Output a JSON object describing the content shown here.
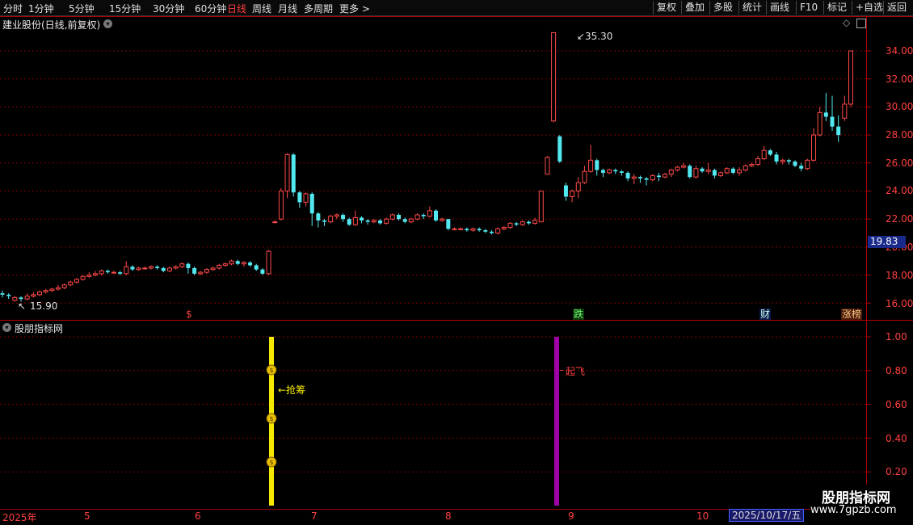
{
  "toolbar": {
    "periods": [
      "分时",
      "1分钟",
      "5分钟",
      "15分钟",
      "30分钟",
      "60分钟",
      "日线",
      "周线",
      "月线",
      "多周期",
      "更多 >"
    ],
    "active_period": "日线",
    "right_buttons": [
      "复权",
      "叠加",
      "多股",
      "统计",
      "画线",
      "F10",
      "标记",
      "+自选",
      "返回"
    ]
  },
  "stock_title": "建业股份(日线,前复权)",
  "indicator_title": "股朋指标网",
  "price_axis": [
    "34.00",
    "32.00",
    "30.00",
    "28.00",
    "26.00",
    "24.00",
    "22.00",
    "20.00",
    "18.00",
    "16.00"
  ],
  "current_price_tag": "19.83",
  "indicator_axis": [
    "1.00",
    "0.80",
    "0.60",
    "0.40",
    "0.20"
  ],
  "annotations": {
    "high": "35.30",
    "low": "15.90",
    "grab_chips": "←抢筹",
    "take_off": "起飞"
  },
  "badges": {
    "s_marker": "$",
    "fall": "跌",
    "finance": "财",
    "surge_list": "涨榜"
  },
  "dates": {
    "year": "2025年",
    "m5": "5",
    "m6": "6",
    "m7": "7",
    "m8": "8",
    "m9": "9",
    "m10": "10",
    "current_date": "2025/10/17/五"
  },
  "watermark": {
    "name": "股朋指标网",
    "url": "www.7gpzb.com"
  },
  "colors": {
    "up": "#ff4a4a",
    "down": "#52e8f0",
    "grid": "#7a0000",
    "bar_yellow": "#f5e800",
    "bar_purple": "#a000a8"
  },
  "chart_data": {
    "type": "candlestick",
    "ylim": [
      15.5,
      35.5
    ],
    "indicator_ylim": [
      0,
      1.05
    ],
    "indicator_bars": [
      {
        "label": "抢筹",
        "value": 1.0,
        "color": "yellow"
      },
      {
        "label": "起飞",
        "value": 1.0,
        "color": "purple"
      }
    ],
    "candles": [
      [
        16.7,
        16.6,
        16.9,
        16.4
      ],
      [
        16.6,
        16.5,
        16.7,
        16.3
      ],
      [
        16.2,
        16.4,
        16.5,
        16.1
      ],
      [
        16.4,
        16.3,
        16.5,
        16.1
      ],
      [
        16.3,
        16.5,
        16.7,
        16.2
      ],
      [
        16.5,
        16.6,
        16.8,
        16.4
      ],
      [
        16.6,
        16.8,
        16.9,
        16.5
      ],
      [
        16.8,
        16.9,
        17.0,
        16.7
      ],
      [
        16.9,
        17.0,
        17.1,
        16.8
      ],
      [
        17.0,
        17.1,
        17.3,
        16.9
      ],
      [
        17.1,
        17.3,
        17.4,
        17.0
      ],
      [
        17.3,
        17.5,
        17.6,
        17.2
      ],
      [
        17.5,
        17.7,
        17.8,
        17.4
      ],
      [
        17.7,
        17.9,
        18.0,
        17.6
      ],
      [
        17.9,
        18.0,
        18.2,
        17.8
      ],
      [
        18.0,
        18.1,
        18.3,
        17.9
      ],
      [
        18.1,
        18.3,
        18.4,
        18.0
      ],
      [
        18.3,
        18.2,
        18.4,
        18.1
      ],
      [
        18.2,
        18.2,
        18.3,
        18.1
      ],
      [
        18.2,
        18.1,
        18.3,
        18.0
      ],
      [
        18.1,
        18.6,
        19.0,
        18.0
      ],
      [
        18.6,
        18.4,
        18.7,
        18.3
      ],
      [
        18.4,
        18.5,
        18.6,
        18.3
      ],
      [
        18.5,
        18.5,
        18.6,
        18.4
      ],
      [
        18.5,
        18.6,
        18.7,
        18.4
      ],
      [
        18.6,
        18.5,
        18.7,
        18.4
      ],
      [
        18.5,
        18.3,
        18.6,
        18.2
      ],
      [
        18.3,
        18.5,
        18.6,
        18.2
      ],
      [
        18.5,
        18.6,
        18.7,
        18.4
      ],
      [
        18.6,
        18.8,
        18.9,
        18.5
      ],
      [
        18.8,
        18.5,
        18.9,
        18.1
      ],
      [
        18.5,
        18.1,
        18.6,
        18.0
      ],
      [
        18.1,
        18.2,
        18.3,
        18.0
      ],
      [
        18.2,
        18.4,
        18.5,
        18.1
      ],
      [
        18.4,
        18.5,
        18.6,
        18.3
      ],
      [
        18.5,
        18.7,
        18.8,
        18.4
      ],
      [
        18.7,
        18.8,
        18.9,
        18.6
      ],
      [
        18.8,
        19.0,
        19.1,
        18.7
      ],
      [
        19.0,
        18.8,
        19.1,
        18.7
      ],
      [
        18.8,
        18.9,
        19.0,
        18.6
      ],
      [
        18.9,
        18.7,
        19.0,
        18.6
      ],
      [
        18.7,
        18.4,
        18.8,
        18.3
      ],
      [
        18.4,
        18.1,
        18.5,
        18.0
      ],
      [
        18.1,
        19.7,
        19.8,
        18.0
      ],
      [
        21.8,
        21.8,
        21.9,
        21.7
      ],
      [
        22.0,
        24.0,
        24.2,
        21.9
      ],
      [
        24.0,
        26.6,
        26.7,
        23.5
      ],
      [
        26.6,
        23.9,
        26.7,
        23.6
      ],
      [
        23.9,
        23.2,
        24.0,
        22.8
      ],
      [
        23.2,
        23.8,
        23.9,
        22.9
      ],
      [
        23.8,
        22.4,
        23.9,
        21.5
      ],
      [
        22.4,
        21.9,
        22.5,
        21.4
      ],
      [
        21.9,
        21.8,
        22.0,
        21.5
      ],
      [
        21.8,
        22.2,
        22.3,
        21.7
      ],
      [
        22.2,
        22.3,
        22.4,
        22.0
      ],
      [
        22.3,
        22.0,
        22.4,
        21.8
      ],
      [
        22.0,
        21.6,
        22.1,
        21.5
      ],
      [
        21.6,
        22.1,
        22.6,
        21.5
      ],
      [
        22.1,
        21.9,
        22.2,
        21.7
      ],
      [
        21.9,
        21.8,
        22.0,
        21.6
      ],
      [
        21.8,
        21.9,
        22.0,
        21.7
      ],
      [
        21.9,
        21.7,
        22.0,
        21.6
      ],
      [
        21.7,
        22.0,
        22.1,
        21.6
      ],
      [
        22.0,
        22.3,
        22.4,
        21.9
      ],
      [
        22.3,
        22.0,
        22.4,
        21.9
      ],
      [
        22.0,
        21.8,
        22.1,
        21.7
      ],
      [
        21.8,
        22.0,
        22.1,
        21.7
      ],
      [
        22.0,
        22.3,
        22.4,
        21.9
      ],
      [
        22.3,
        22.2,
        22.4,
        22.0
      ],
      [
        22.2,
        22.6,
        22.9,
        22.1
      ],
      [
        22.6,
        21.9,
        22.7,
        21.8
      ],
      [
        21.9,
        22.0,
        22.1,
        21.8
      ],
      [
        22.0,
        21.3,
        22.0,
        21.2
      ],
      [
        21.3,
        21.3,
        21.4,
        21.2
      ],
      [
        21.3,
        21.3,
        21.4,
        21.2
      ],
      [
        21.3,
        21.2,
        21.4,
        21.1
      ],
      [
        21.2,
        21.3,
        21.4,
        21.1
      ],
      [
        21.3,
        21.2,
        21.4,
        21.1
      ],
      [
        21.2,
        21.1,
        21.3,
        21.0
      ],
      [
        21.1,
        21.0,
        21.2,
        20.9
      ],
      [
        21.0,
        21.3,
        21.4,
        20.9
      ],
      [
        21.3,
        21.4,
        21.5,
        21.2
      ],
      [
        21.4,
        21.7,
        21.8,
        21.3
      ],
      [
        21.7,
        21.6,
        21.8,
        21.5
      ],
      [
        21.6,
        21.8,
        21.9,
        21.5
      ],
      [
        21.8,
        21.7,
        21.9,
        21.6
      ],
      [
        21.7,
        21.9,
        22.1,
        21.6
      ],
      [
        21.8,
        24.0,
        24.0,
        21.8
      ],
      [
        25.2,
        26.4,
        26.5,
        25.2
      ],
      [
        29.0,
        35.3,
        35.3,
        28.9
      ],
      [
        27.9,
        26.1,
        28.0,
        26.0
      ],
      [
        24.4,
        23.6,
        24.6,
        23.3
      ],
      [
        23.6,
        24.0,
        24.1,
        23.2
      ],
      [
        24.0,
        24.6,
        25.0,
        23.5
      ],
      [
        24.6,
        25.4,
        25.8,
        24.5
      ],
      [
        25.4,
        26.2,
        27.3,
        25.3
      ],
      [
        26.2,
        25.5,
        26.3,
        25.1
      ],
      [
        25.5,
        25.3,
        25.6,
        25.0
      ],
      [
        25.3,
        25.5,
        25.6,
        25.2
      ],
      [
        25.5,
        25.4,
        25.6,
        25.2
      ],
      [
        25.4,
        25.3,
        25.5,
        25.1
      ],
      [
        25.3,
        24.9,
        25.4,
        24.7
      ],
      [
        24.9,
        25.0,
        25.2,
        24.5
      ],
      [
        25.0,
        24.9,
        25.1,
        24.6
      ],
      [
        24.9,
        24.8,
        25.0,
        24.4
      ],
      [
        24.8,
        25.1,
        25.2,
        24.7
      ],
      [
        25.1,
        25.0,
        25.3,
        24.7
      ],
      [
        25.0,
        25.2,
        25.3,
        24.9
      ],
      [
        25.2,
        25.5,
        25.6,
        25.0
      ],
      [
        25.5,
        25.7,
        25.8,
        25.4
      ],
      [
        25.7,
        25.8,
        26.0,
        25.6
      ],
      [
        25.8,
        25.0,
        25.9,
        24.9
      ],
      [
        25.0,
        25.6,
        25.8,
        24.9
      ],
      [
        25.6,
        25.4,
        25.7,
        25.3
      ],
      [
        25.4,
        25.5,
        26.0,
        25.2
      ],
      [
        25.5,
        25.1,
        25.6,
        24.9
      ],
      [
        25.1,
        25.3,
        25.4,
        25.0
      ],
      [
        25.3,
        25.6,
        25.7,
        25.2
      ],
      [
        25.6,
        25.3,
        25.7,
        25.2
      ],
      [
        25.3,
        25.5,
        25.7,
        25.1
      ],
      [
        25.5,
        25.8,
        25.9,
        25.4
      ],
      [
        25.8,
        25.9,
        26.0,
        25.7
      ],
      [
        25.9,
        26.3,
        26.5,
        25.8
      ],
      [
        26.3,
        26.9,
        27.2,
        26.2
      ],
      [
        26.9,
        26.6,
        27.0,
        26.5
      ],
      [
        26.6,
        26.1,
        26.8,
        25.9
      ],
      [
        26.1,
        26.2,
        26.3,
        25.9
      ],
      [
        26.2,
        26.1,
        26.3,
        25.9
      ],
      [
        26.1,
        25.8,
        26.2,
        25.7
      ],
      [
        25.8,
        25.6,
        26.0,
        25.4
      ],
      [
        25.6,
        26.2,
        26.3,
        25.5
      ],
      [
        26.2,
        28.0,
        28.5,
        26.1
      ],
      [
        28.0,
        29.6,
        30.0,
        27.9
      ],
      [
        29.6,
        29.3,
        31.0,
        29.0
      ],
      [
        29.3,
        28.6,
        30.8,
        28.3
      ],
      [
        28.6,
        28.0,
        29.4,
        27.5
      ],
      [
        29.2,
        30.2,
        30.8,
        29.0
      ],
      [
        30.2,
        34.0,
        34.0,
        30.0
      ]
    ]
  }
}
